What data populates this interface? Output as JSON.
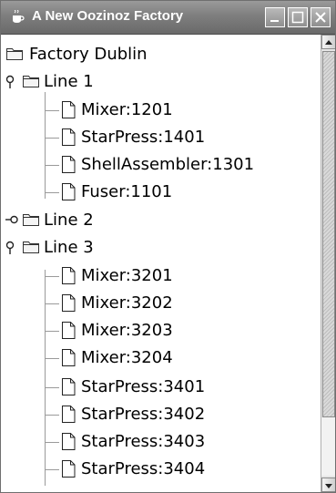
{
  "window": {
    "title": "A New Oozinoz Factory"
  },
  "tree": {
    "root_label": "Factory Dublin",
    "line1": {
      "label": "Line 1",
      "expanded": true,
      "items": [
        "Mixer:1201",
        "StarPress:1401",
        "ShellAssembler:1301",
        "Fuser:1101"
      ]
    },
    "line2": {
      "label": "Line 2",
      "expanded": false
    },
    "line3": {
      "label": "Line 3",
      "expanded": true,
      "items": [
        "Mixer:3201",
        "Mixer:3202",
        "Mixer:3203",
        "Mixer:3204",
        "StarPress:3401",
        "StarPress:3402",
        "StarPress:3403",
        "StarPress:3404"
      ]
    }
  },
  "icons": {
    "app": "java-cup-icon",
    "folder": "folder-icon",
    "leaf": "document-icon",
    "expanded_handle": "expanded-handle-icon",
    "collapsed_handle": "collapsed-handle-icon"
  }
}
